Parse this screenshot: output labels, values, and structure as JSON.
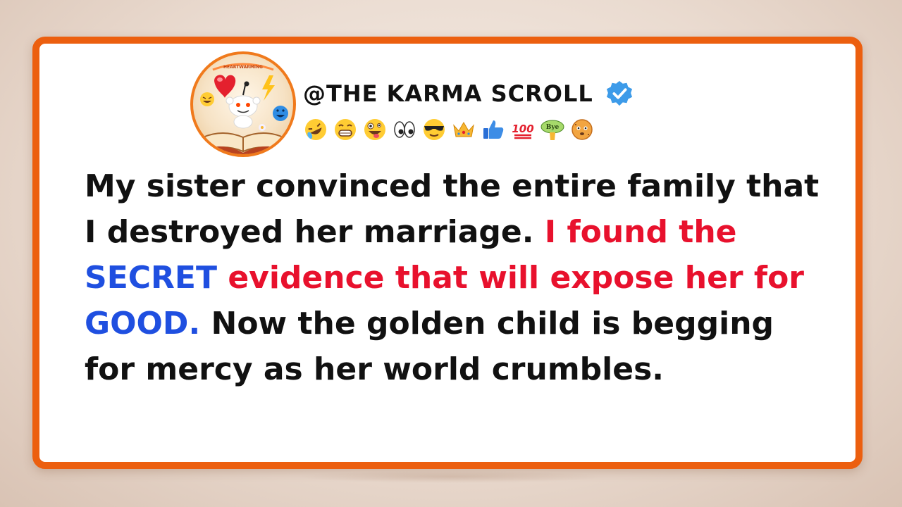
{
  "profile": {
    "handle": "@THE KARMA SCROLL",
    "avatar_icon": "reddit-mascot-book-icon",
    "avatar_banner": "HEARTWARMING",
    "verified_icon": "verified-badge-icon",
    "emojis": [
      "rolling-laughing-emoji",
      "grinning-teeth-emoji",
      "zany-face-emoji",
      "eyes-emoji",
      "sunglasses-face-emoji",
      "crown-emoji",
      "thumbs-up-emoji",
      "hundred-points-emoji",
      "bye-emoji",
      "cookie-face-emoji"
    ]
  },
  "headline": {
    "part1": "My sister convinced the entire family that I destroyed her marriage. ",
    "part2": "I found the ",
    "part3": "SECRET",
    "part4": " evidence that will expose her for ",
    "part5": "GOOD.",
    "part6": " Now the golden child is begging for mercy as her world crumbles."
  },
  "colors": {
    "frame": "#ec5f0f",
    "highlight_red": "#e8112d",
    "highlight_blue": "#1f4fe0",
    "verified": "#3d9be9"
  }
}
